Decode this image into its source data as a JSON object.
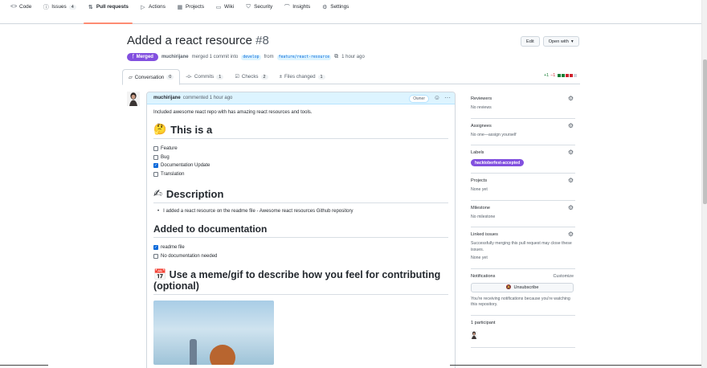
{
  "repo_nav": {
    "items": [
      {
        "icon": "code-icon",
        "glyph": "<>",
        "label": "Code"
      },
      {
        "icon": "issue-icon",
        "glyph": "ⓘ",
        "label": "Issues",
        "count": "4"
      },
      {
        "icon": "pull-request-icon",
        "glyph": "⇅",
        "label": "Pull requests"
      },
      {
        "icon": "actions-icon",
        "glyph": "▷",
        "label": "Actions"
      },
      {
        "icon": "projects-icon",
        "glyph": "▦",
        "label": "Projects"
      },
      {
        "icon": "wiki-icon",
        "glyph": "▭",
        "label": "Wiki"
      },
      {
        "icon": "security-icon",
        "glyph": "⛉",
        "label": "Security"
      },
      {
        "icon": "insights-icon",
        "glyph": "⌒",
        "label": "Insights"
      },
      {
        "icon": "settings-icon",
        "glyph": "⚙",
        "label": "Settings"
      }
    ]
  },
  "pr": {
    "title": "Added a react resource",
    "number": "#8",
    "edit_label": "Edit",
    "open_with_label": "Open with",
    "status": "Merged",
    "author": "muchirijane",
    "merge_text": "merged 1 commit into",
    "base_branch": "develop",
    "from_text": "from",
    "head_branch": "feature/react-resource",
    "time": "1 hour ago"
  },
  "tabs": [
    {
      "icon": "conversation-icon",
      "glyph": "▱",
      "label": "Conversation",
      "count": "0"
    },
    {
      "icon": "commits-icon",
      "glyph": "-o-",
      "label": "Commits",
      "count": "1"
    },
    {
      "icon": "checks-icon",
      "glyph": "☑",
      "label": "Checks",
      "count": "2"
    },
    {
      "icon": "files-icon",
      "glyph": "±",
      "label": "Files changed",
      "count": "1"
    }
  ],
  "diffstat": {
    "additions": "+1",
    "deletions": "−1",
    "colors": [
      "#1a7f37",
      "#1a7f37",
      "#cf222e",
      "#cf222e",
      "#d0d7de"
    ]
  },
  "comment": {
    "author": "muchirijane",
    "meta": "commented 1 hour ago",
    "role_badge": "Owner",
    "intro": "Included awesome react repo with has amazing react resources and tools.",
    "h_this_is": "This is a",
    "emoji_thinking": "🤔",
    "type_tasks": [
      {
        "label": "Feature",
        "checked": false
      },
      {
        "label": "Bug",
        "checked": false
      },
      {
        "label": "Documentation Update",
        "checked": true
      },
      {
        "label": "Translation",
        "checked": false
      }
    ],
    "h_description": "Description",
    "emoji_writing": "✍",
    "description_item": "I added a react resource on the readme file - Awesome react resources Github repository",
    "h_added": "Added to documentation",
    "doc_tasks": [
      {
        "label": "readme file",
        "checked": true
      },
      {
        "label": "No documentation needed",
        "checked": false
      }
    ],
    "h_meme": "Use a meme/gif to describe how you feel for contributing (optional)",
    "emoji_meme": "📅"
  },
  "sidebar": {
    "reviewers_title": "Reviewers",
    "reviewers_value": "No reviews",
    "assignees_title": "Assignees",
    "assignees_value": "No one—assign yourself",
    "labels_title": "Labels",
    "label_name": "hacktoberfest-accepted",
    "label_color": "#8250df",
    "projects_title": "Projects",
    "projects_value": "None yet",
    "milestone_title": "Milestone",
    "milestone_value": "No milestone",
    "linked_title": "Linked issues",
    "linked_desc": "Successfully merging this pull request may close these issues.",
    "linked_value": "None yet",
    "notifications_title": "Notifications",
    "customize_label": "Customize",
    "unsubscribe_label": "Unsubscribe",
    "notifications_desc": "You're receiving notifications because you're watching this repository.",
    "participants_title": "1 participant"
  }
}
